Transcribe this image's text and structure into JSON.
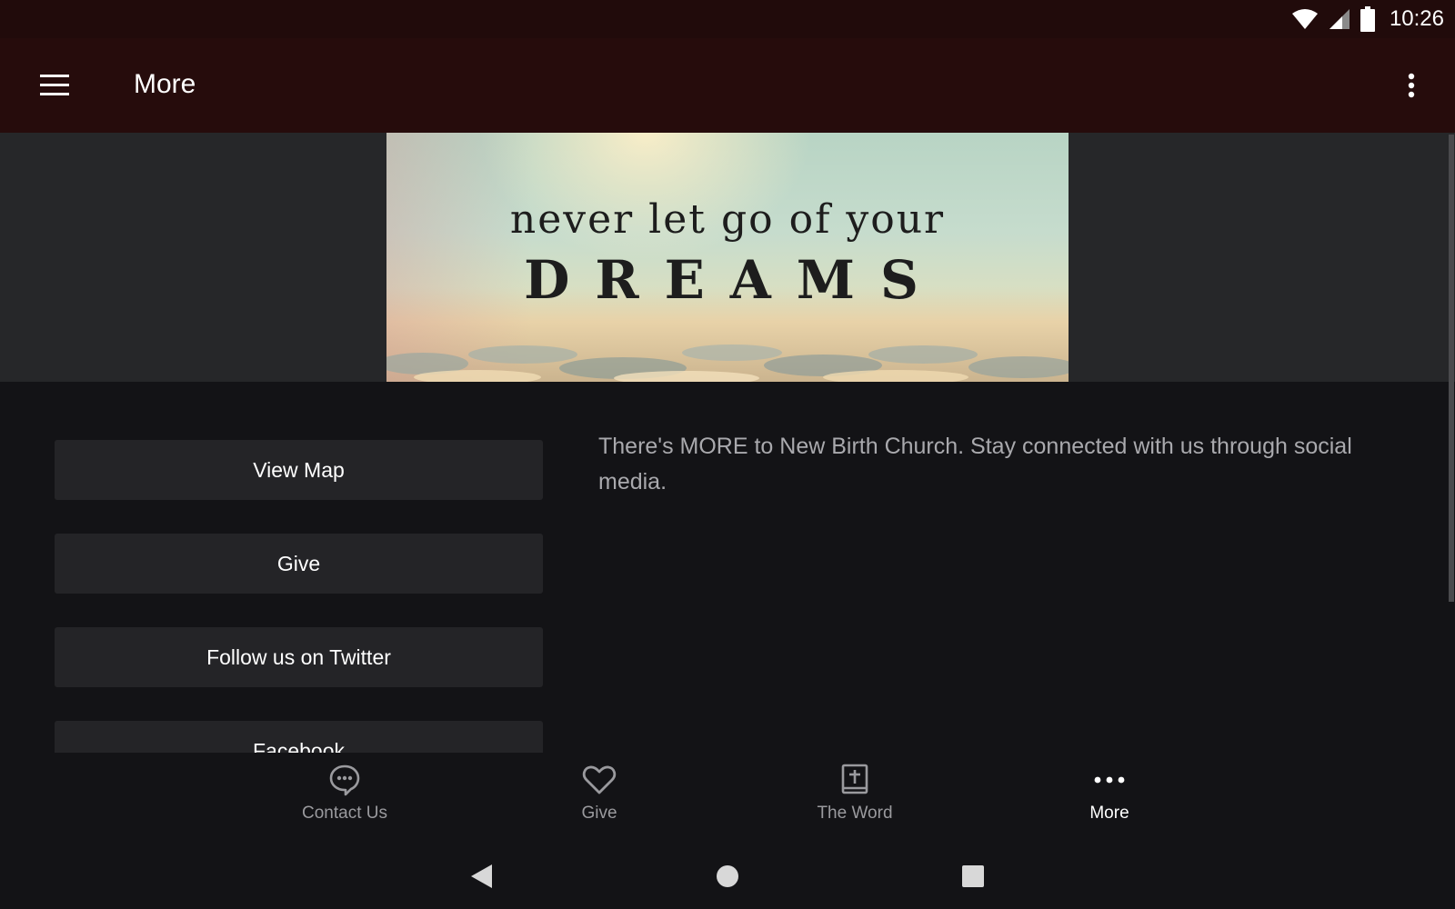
{
  "status_bar": {
    "time": "10:26",
    "icons": [
      "wifi-icon",
      "cellular-signal-icon",
      "battery-icon"
    ]
  },
  "app_bar": {
    "title": "More",
    "menu_icon": "hamburger-menu-icon",
    "overflow_icon": "more-vertical-icon"
  },
  "hero": {
    "line1": "never let go of your",
    "line2": "DREAMS"
  },
  "buttons": [
    {
      "label": "View Map"
    },
    {
      "label": "Give"
    },
    {
      "label": "Follow us on Twitter"
    },
    {
      "label": "Facebook"
    }
  ],
  "description": "There's MORE to New Birth Church. Stay connected with us through social media.",
  "bottom_nav": [
    {
      "label": "Contact Us",
      "icon": "chat-bubble-icon"
    },
    {
      "label": "Give",
      "icon": "heart-icon"
    },
    {
      "label": "The Word",
      "icon": "bible-icon"
    },
    {
      "label": "More",
      "icon": "more-horizontal-icon",
      "active": true
    }
  ],
  "system_nav": {
    "icons": [
      "back-icon",
      "home-icon",
      "recents-icon"
    ]
  },
  "colors": {
    "status_bar_bg": "#210b0b",
    "app_bar_bg": "#260c0c",
    "content_bg": "#131316",
    "button_bg": "#242427",
    "description_text": "#a9a9ad",
    "nav_inactive": "#9a9a9e",
    "nav_active": "#ffffff"
  }
}
